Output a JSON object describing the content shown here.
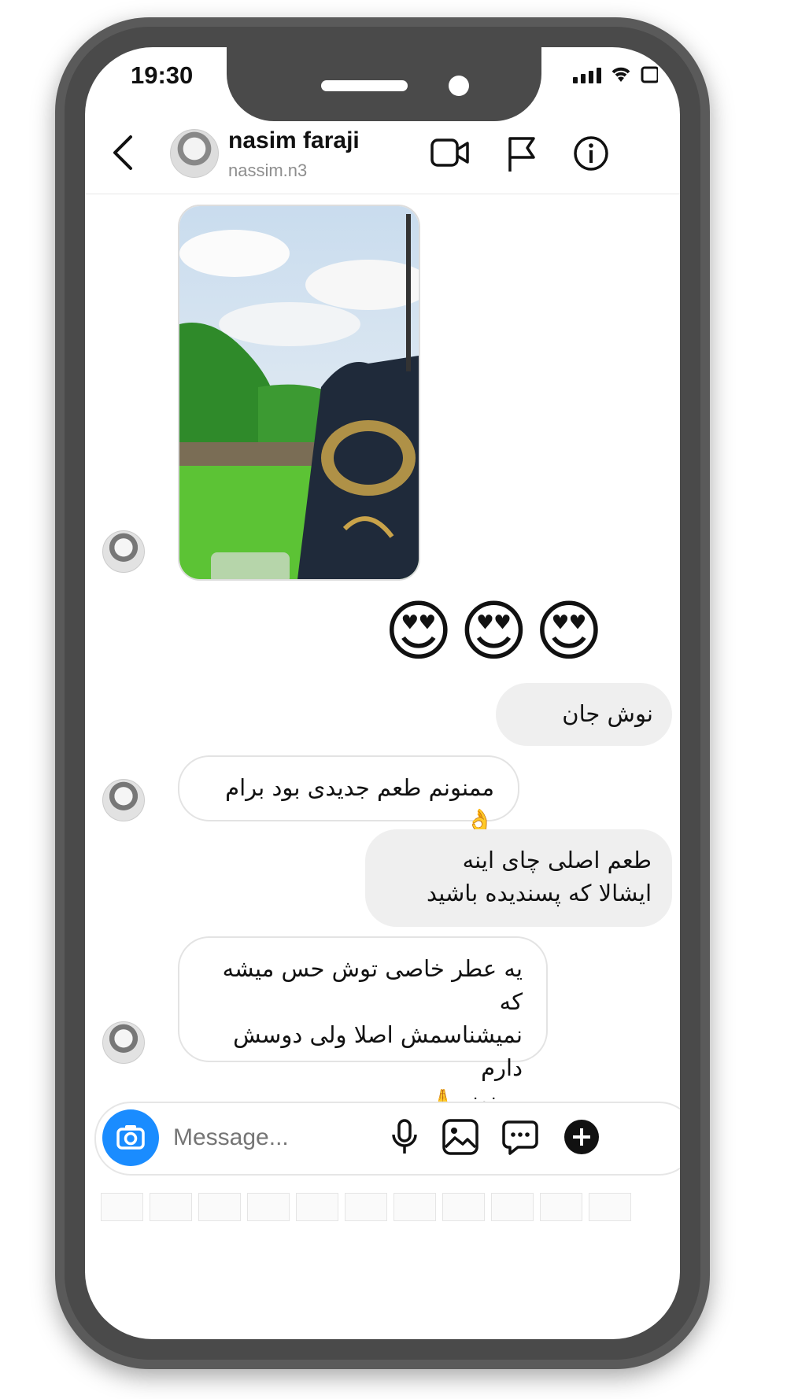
{
  "status": {
    "time": "19:30"
  },
  "header": {
    "name": "nasim faraji",
    "username": "nassim.n3"
  },
  "messages": {
    "emojis": "😍😍😍",
    "out_1": "نوش جان",
    "in_1": "ممنونم طعم جدیدی بود برام 👌",
    "out_2_line1": "طعم اصلی چای اینه",
    "out_2_line2": "ایشالا که پسندیده باشید",
    "in_2_line1": "یه عطر خاصی توش حس میشه که",
    "in_2_line2": "نمیشناسمش اصلا ولی دوسش دارم",
    "in_2_line3": "ممنونم🙏"
  },
  "composer": {
    "placeholder": "Message..."
  },
  "colors": {
    "accent": "#1a8cff",
    "incoming_bg": "#ffffff",
    "outgoing_bg": "#efefef"
  },
  "icons": [
    "chevron-left-icon",
    "video-camera-icon",
    "flag-icon",
    "info-icon",
    "camera-icon",
    "microphone-icon",
    "gallery-icon",
    "sticker-icon",
    "plus-icon"
  ]
}
